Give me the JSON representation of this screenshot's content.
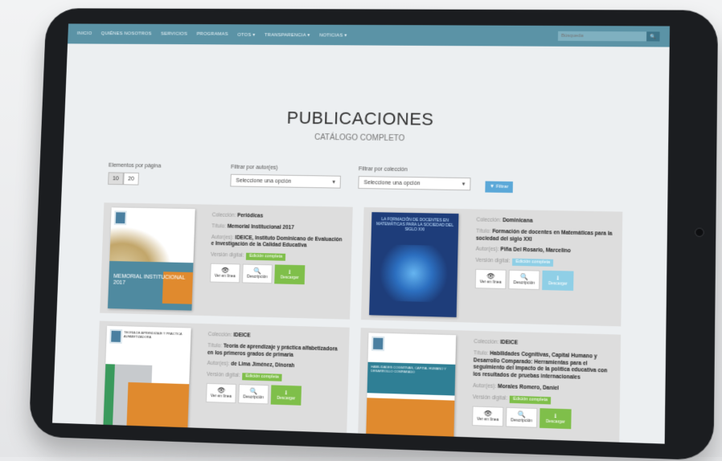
{
  "nav": {
    "items": [
      "INICIO",
      "QUIÉNES NOSOTROS",
      "SERVICIOS",
      "PROGRAMAS",
      "OTOS ▾",
      "TRANSPARENCIA ▾",
      "NOTICIAS ▾"
    ],
    "search_placeholder": "Búsqueda",
    "search_icon": "search-icon"
  },
  "header": {
    "title": "PUBLICACIONES",
    "subtitle": "CATÁLOGO COMPLETO"
  },
  "filters": {
    "per_page_label": "Elementos por página",
    "per_page_options": [
      "10",
      "20"
    ],
    "author_label": "Filtrar por autor(es)",
    "author_value": "Seleccione una opción",
    "collection_label": "Filtrar por colección",
    "collection_value": "Seleccione una opción",
    "filter_button": "▼ Filtrar"
  },
  "labels": {
    "collection": "Colección:",
    "title": "Título:",
    "authors": "Autor(es):",
    "digital": "Versión digital:",
    "view_online": "Ver en línea",
    "description": "Descripción",
    "download": "Descargar"
  },
  "publications": [
    {
      "collection": "Periódicas",
      "title": "Memorial Institucional 2017",
      "authors": "IDEICE, Instituto Dominicano de Evaluación e Investigación de la Calidad Educativa",
      "digital": "Edición completa",
      "cover_text": "MEMORIAL INSTITUCIONAL 2017"
    },
    {
      "collection": "Dominicana",
      "title": "Formación de docentes en Matemáticas para la sociedad del siglo XXI",
      "authors": "Piña Del Rosario, Marcelino",
      "digital": "Edición completa",
      "cover_text": "LA FORMACIÓN DE DOCENTES EN MATEMÁTICAS PARA LA SOCIEDAD DEL SIGLO XXI"
    },
    {
      "collection": "IDEICE",
      "title": "Teoría de aprendizaje y práctica alfabetizadora en los primeros grados de primaria",
      "authors": "de Lima Jiménez, Dinorah",
      "digital": "Edición completa",
      "cover_text": "TEORÍA DE APRENDIZAJE Y PRÁCTICA ALFABETIZADORA"
    },
    {
      "collection": "IDEICE",
      "title": "Habilidades Cognitivas, Capital Humano y Desarrollo Comparado: Herramientas para el seguimiento del impacto de la política educativa con los resultados de pruebas internacionales",
      "authors": "Morales Romero, Daniel",
      "digital": "Edición completa",
      "cover_text": "HABILIDADES COGNITIVAS, CAPITAL HUMANO Y DESARROLLO COMPARADO"
    }
  ],
  "colors": {
    "nav": "#5b93a6",
    "download": "#7fbf4a",
    "download_alt": "#8fcfe6",
    "filter_button": "#5ba8d8"
  }
}
